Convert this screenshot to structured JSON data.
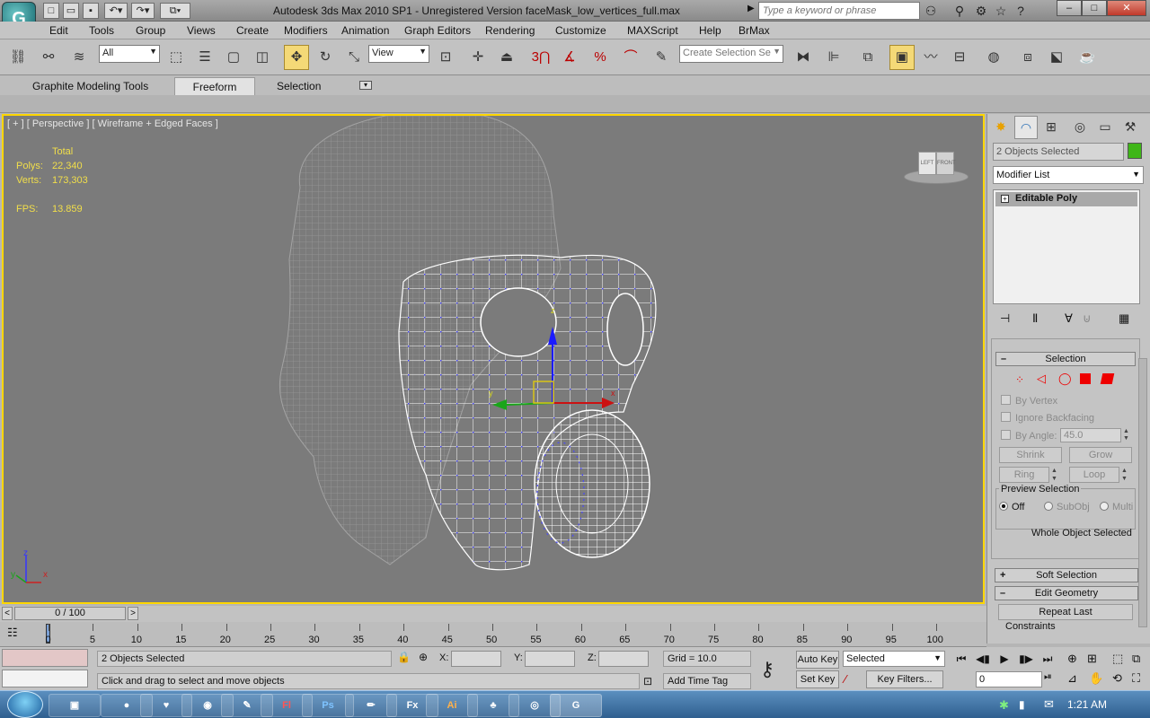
{
  "window": {
    "title": "Autodesk 3ds Max  2010 SP1   -  Unregistered Version      faceMask_low_vertices_full.max",
    "app_logo": "G",
    "search_placeholder": "Type a keyword or phrase",
    "minimize": "–",
    "maximize": "□",
    "close": "✕"
  },
  "menubar": {
    "items": [
      "Edit",
      "Tools",
      "Group",
      "Views",
      "Create",
      "Modifiers",
      "Animation",
      "Graph Editors",
      "Rendering",
      "Customize",
      "MAXScript",
      "Help",
      "BrMax"
    ]
  },
  "toolbar": {
    "selection_filter": "All",
    "ref_coord": "View",
    "snap_3": "3",
    "named_selection": "Create Selection Se"
  },
  "ribbon": {
    "tabs": [
      "Graphite Modeling Tools",
      "Freeform",
      "Selection"
    ],
    "active_tab": "Freeform"
  },
  "viewport": {
    "label": "[ + ] [ Perspective ] [ Wireframe + Edged Faces ]",
    "stats": {
      "total_label": "Total",
      "polys_label": "Polys:",
      "polys_value": "22,340",
      "verts_label": "Verts:",
      "verts_value": "173,303",
      "fps_label": "FPS:",
      "fps_value": "13.859"
    },
    "viewcube": {
      "top": "LEFT",
      "front": "FRONT"
    },
    "axes": {
      "z": "z",
      "y": "y",
      "x": "x"
    },
    "gizmo": {
      "y": "y",
      "x": "x",
      "z": "z"
    }
  },
  "command_panel": {
    "selected_objects": "2 Objects Selected",
    "object_color": "#3fb618",
    "modifier_list": "Modifier List",
    "stack_item": "Editable Poly",
    "selection_rollout": {
      "title": "Selection",
      "by_vertex": "By Vertex",
      "ignore_backfacing": "Ignore Backfacing",
      "by_angle": "By Angle:",
      "angle_value": "45.0",
      "shrink": "Shrink",
      "grow": "Grow",
      "ring": "Ring",
      "loop": "Loop",
      "preview_title": "Preview Selection",
      "preview_off": "Off",
      "preview_subobj": "SubObj",
      "preview_multi": "Multi",
      "status": "Whole Object Selected"
    },
    "soft_selection": "Soft Selection",
    "edit_geometry": "Edit Geometry",
    "repeat_last": "Repeat Last",
    "constraints": "Constraints"
  },
  "timeline": {
    "frame_counter": "0 / 100",
    "prev": "<",
    "next": ">",
    "ticks": [
      "0",
      "5",
      "10",
      "15",
      "20",
      "25",
      "30",
      "35",
      "40",
      "45",
      "50",
      "55",
      "60",
      "65",
      "70",
      "75",
      "80",
      "85",
      "90",
      "95",
      "100"
    ]
  },
  "statusbar": {
    "selection_text": "2 Objects Selected",
    "prompt": "Click and drag to select and move objects",
    "x_label": "X:",
    "y_label": "Y:",
    "z_label": "Z:",
    "grid": "Grid = 10.0",
    "add_time_tag": "Add Time Tag",
    "auto_key": "Auto Key",
    "set_key": "Set Key",
    "key_mode": "Selected",
    "key_filters": "Key Filters...",
    "current_frame": "0"
  },
  "taskbar": {
    "apps": [
      "▣",
      "●",
      "♥",
      "◉",
      "✎",
      "Fl",
      "Ps",
      "✏",
      "Fx",
      "Ai",
      "♣",
      "◎",
      "G"
    ],
    "clock": "1:21 AM"
  }
}
